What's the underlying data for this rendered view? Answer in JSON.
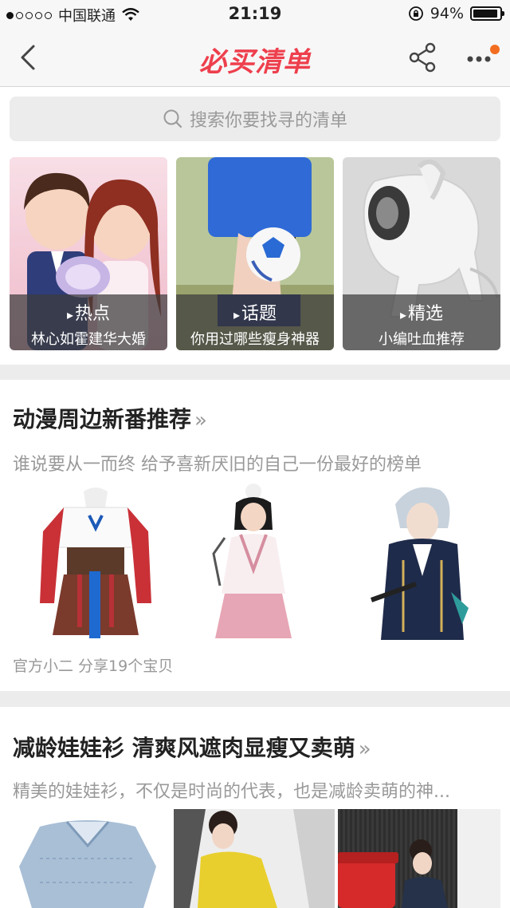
{
  "status_bar": {
    "carrier": "中国联通",
    "time": "21:19",
    "battery": "94%",
    "battery_level": 0.94
  },
  "nav": {
    "title": "必买清单"
  },
  "search": {
    "placeholder": "搜索你要找寻的清单"
  },
  "cards": [
    {
      "tag": "热点",
      "subtitle": "林心如霍建华大婚"
    },
    {
      "tag": "话题",
      "subtitle": "你用过哪些瘦身神器"
    },
    {
      "tag": "精选",
      "subtitle": "小编吐血推荐"
    }
  ],
  "sections": [
    {
      "title": "动漫周边新番推荐",
      "desc": "谁说要从一而终 给予喜新厌旧的自己一份最好的榜单",
      "footer": "官方小二 分享19个宝贝"
    },
    {
      "title": "减龄娃娃衫 清爽风遮肉显瘦又卖萌",
      "desc": "精美的娃娃衫，不仅是时尚的代表，也是减龄卖萌的神..."
    }
  ],
  "colors": {
    "brand": "#ee3f4d",
    "notify_dot": "#f36d21"
  }
}
